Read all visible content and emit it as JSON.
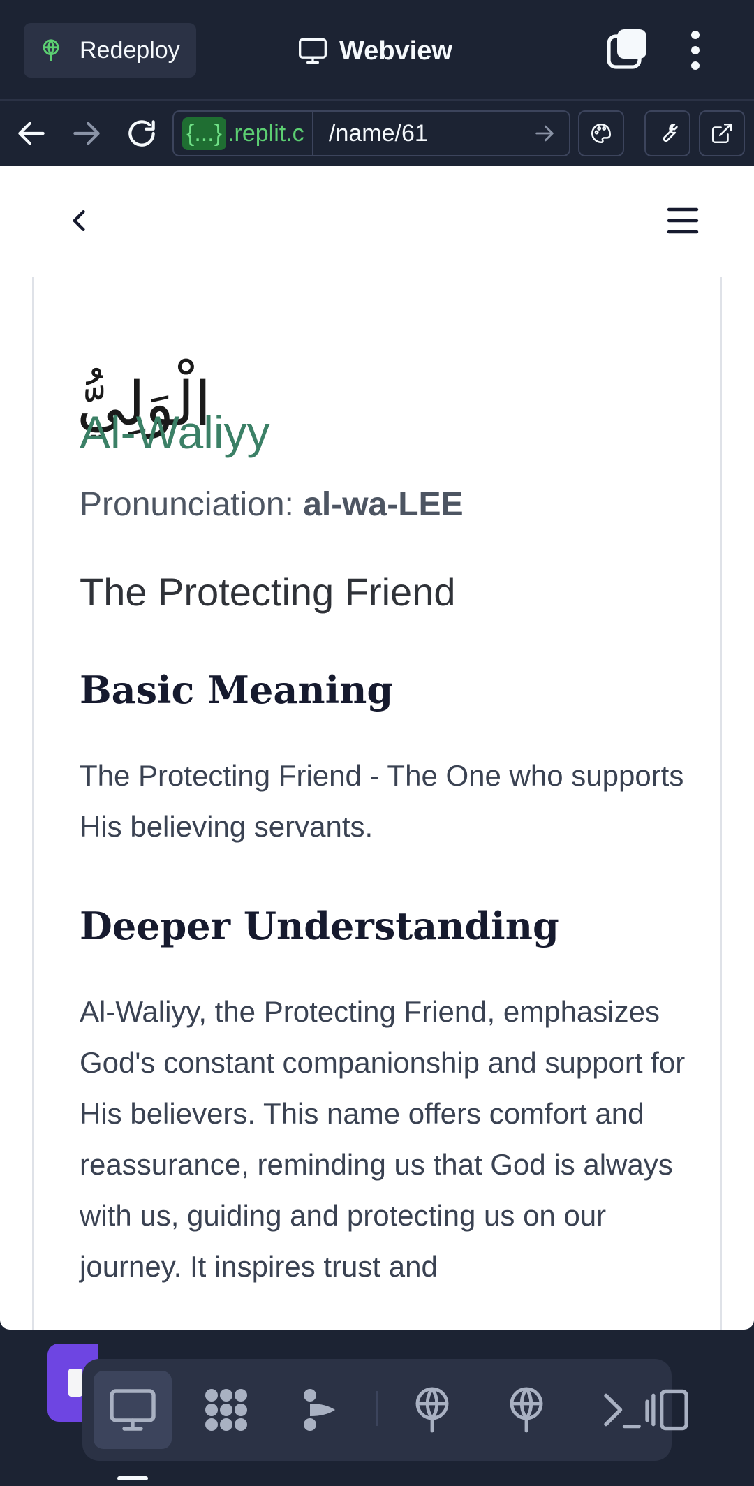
{
  "topbar": {
    "redeploy_label": "Redeploy",
    "title": "Webview"
  },
  "urlbar": {
    "host_chip": "{...}",
    "host_rest": ".replit.c",
    "path": "/name/61"
  },
  "page": {
    "arabic_name": "الْوَلِيُّ",
    "english_name": "Al-Waliyy",
    "pronunciation_label": "Pronunciation: ",
    "pronunciation_value": "al-wa-LEE",
    "meaning_title": "The Protecting Friend",
    "basic_heading": "Basic Meaning",
    "basic_text": "The Protecting Friend - The One who supports His believing servants.",
    "deeper_heading": "Deeper Understanding",
    "deeper_text": "Al-Waliyy, the Protecting Friend, emphasizes God's constant companionship and support for His believers. This name offers comfort and reassurance, reminding us that God is always with us, guiding and protecting us on our journey. It inspires trust and"
  },
  "colors": {
    "accent_green": "#3b8066",
    "background_dark": "#1c2333",
    "dock_accent": "#6e45e2"
  },
  "icons": {
    "redeploy": "deploy-globe-icon",
    "webview": "monitor-icon",
    "tabs": "tabs-icon",
    "more": "kebab-menu-icon",
    "back": "arrow-left-icon",
    "forward": "arrow-right-icon",
    "reload": "reload-icon",
    "palette": "palette-icon",
    "wrench": "wrench-icon",
    "external": "external-link-icon",
    "page_back": "chevron-left-icon",
    "page_menu": "hamburger-menu-icon"
  }
}
